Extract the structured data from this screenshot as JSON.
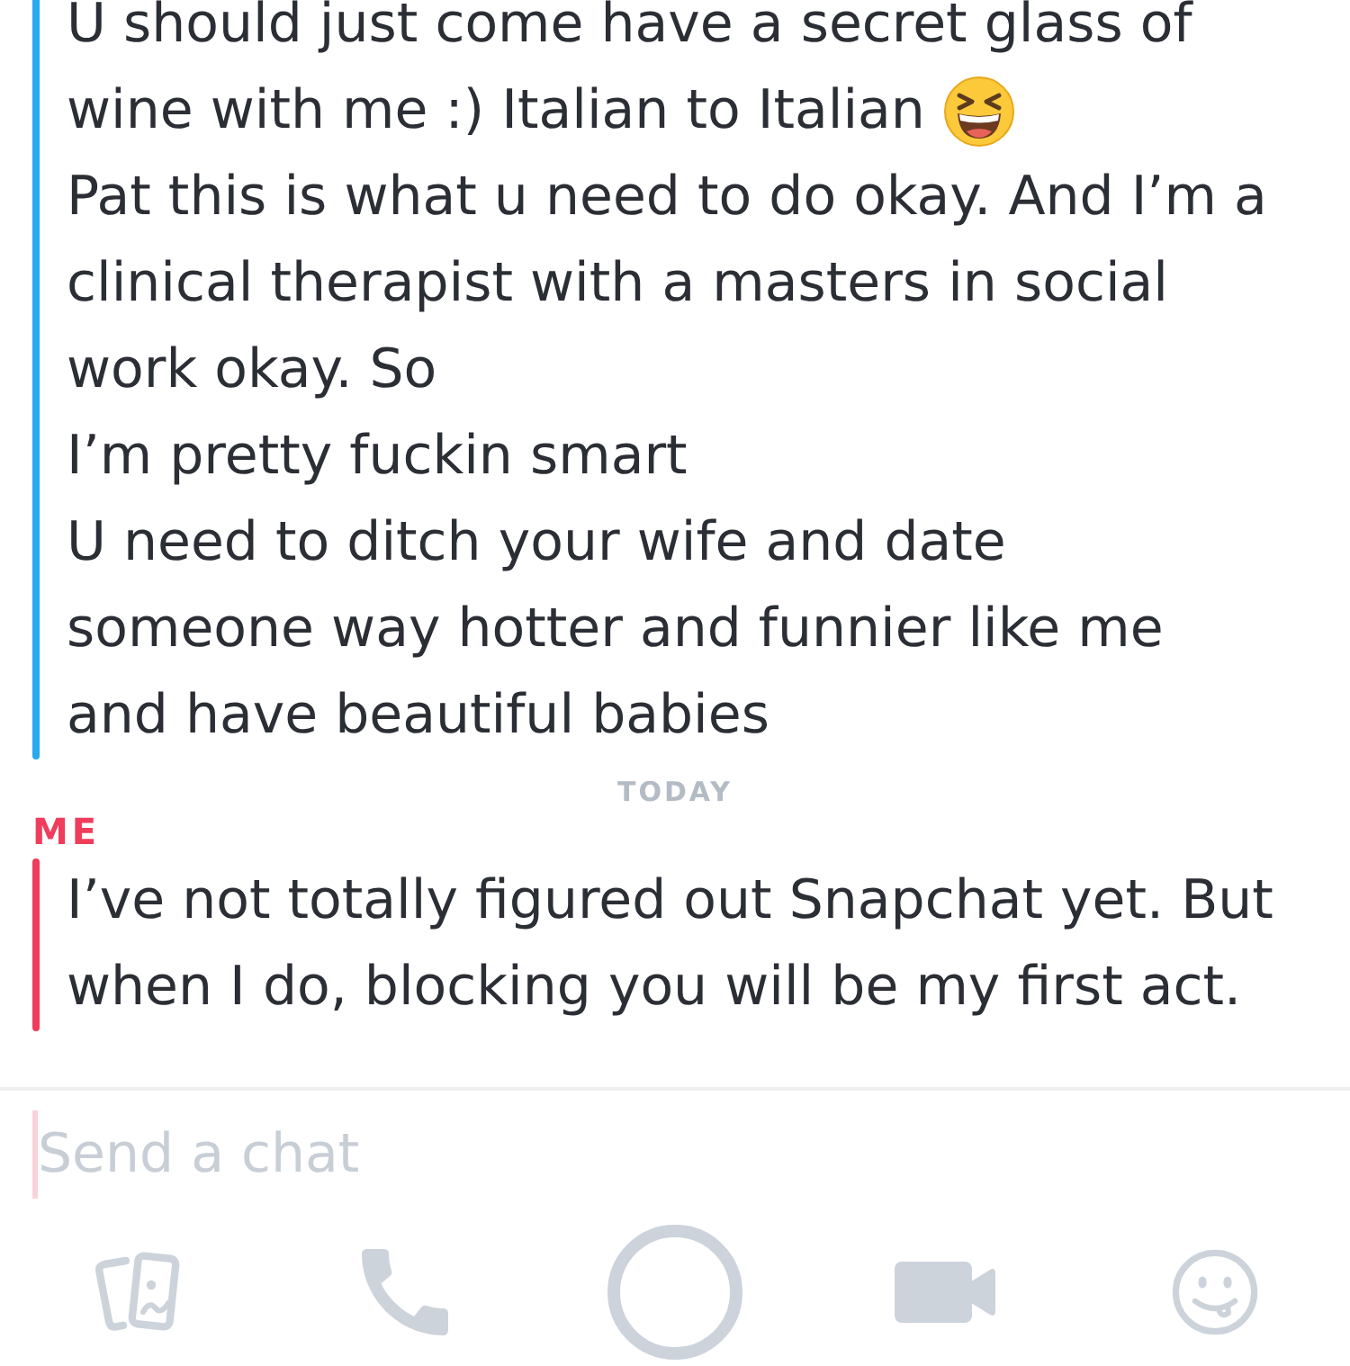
{
  "thread": [
    {
      "kind": "messages",
      "color": "#2aa9ee",
      "messages": [
        {
          "lines": [
            "U should just come have a secret glass of",
            "wine with me :) Italian to Italian"
          ],
          "emoji": true
        },
        {
          "lines": [
            "Pat this is what u need to do okay. And I’m a",
            "clinical therapist with a masters in social",
            "work okay. So"
          ],
          "emoji": false
        },
        {
          "lines": [
            "I’m pretty fuckin smart"
          ],
          "emoji": false
        },
        {
          "lines": [
            "U need to ditch your wife and date",
            "someone way hotter and funnier like me",
            "and have beautiful babies"
          ],
          "emoji": false
        }
      ]
    },
    {
      "kind": "date",
      "label": "TODAY"
    },
    {
      "kind": "messages",
      "sender": "ME",
      "color": "#ef3d5b",
      "messages": [
        {
          "lines": [
            "I’ve not totally figured out Snapchat yet. But",
            "when I do, blocking you will be my first act."
          ],
          "emoji": false
        }
      ]
    }
  ],
  "composer": {
    "placeholder": "Send a chat",
    "focused": true
  }
}
